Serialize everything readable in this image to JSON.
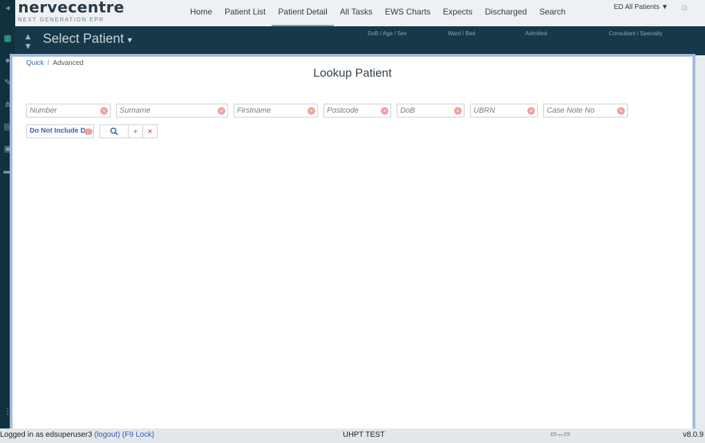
{
  "app": {
    "logo_main": "nervecentre",
    "logo_sub": "NEXT GENERATION EPR"
  },
  "nav": {
    "items": [
      "Home",
      "Patient List",
      "Patient Detail",
      "All Tasks",
      "EWS Charts",
      "Expects",
      "Discharged",
      "Search"
    ],
    "active": "Patient Detail"
  },
  "ward_selector": "ED All Patients ▼",
  "patient_bar": {
    "title": "Select Patient",
    "caret": "▾",
    "columns": [
      "DoB / Age / Sex",
      "Ward / Bed",
      "Admitted",
      "Consultant / Specialty"
    ]
  },
  "left_rail": {
    "icons": [
      "back-icon",
      "tracking-board-icon",
      "user-icon",
      "edit-icon",
      "network-icon",
      "printer-icon",
      "clipboard-icon",
      "bed-icon",
      "more-icon"
    ]
  },
  "dialog": {
    "breadcrumb": {
      "quick": "Quick",
      "separator": "/",
      "advanced": "Advanced"
    },
    "title": "Lookup Patient",
    "fields": {
      "number": {
        "placeholder": "Number",
        "value": ""
      },
      "surname": {
        "placeholder": "Surname",
        "value": ""
      },
      "firstname": {
        "placeholder": "Firstname",
        "value": ""
      },
      "postcode": {
        "placeholder": "Postcode",
        "value": ""
      },
      "dob": {
        "placeholder": "DoB",
        "value": ""
      },
      "ubrn": {
        "placeholder": "UBRN",
        "value": ""
      },
      "case_note_no": {
        "placeholder": "Case Note No",
        "value": ""
      }
    },
    "do_not_include": "Do Not Include D",
    "buttons": {
      "search": "⚲",
      "add": "+",
      "clear": "×"
    }
  },
  "status_bar": {
    "logged_in_prefix": "Logged in as edsuperuser3",
    "logout": "(logout)",
    "lock": "(F9 Lock)",
    "environment": "UHPT TEST",
    "version": "v8.0.9"
  },
  "colors": {
    "rail_bg": "#12313f",
    "patient_bar_bg": "#163848",
    "modal_border": "#9fb9da",
    "accent": "#3b5fa8",
    "clear_badge": "#f0a1a0"
  }
}
